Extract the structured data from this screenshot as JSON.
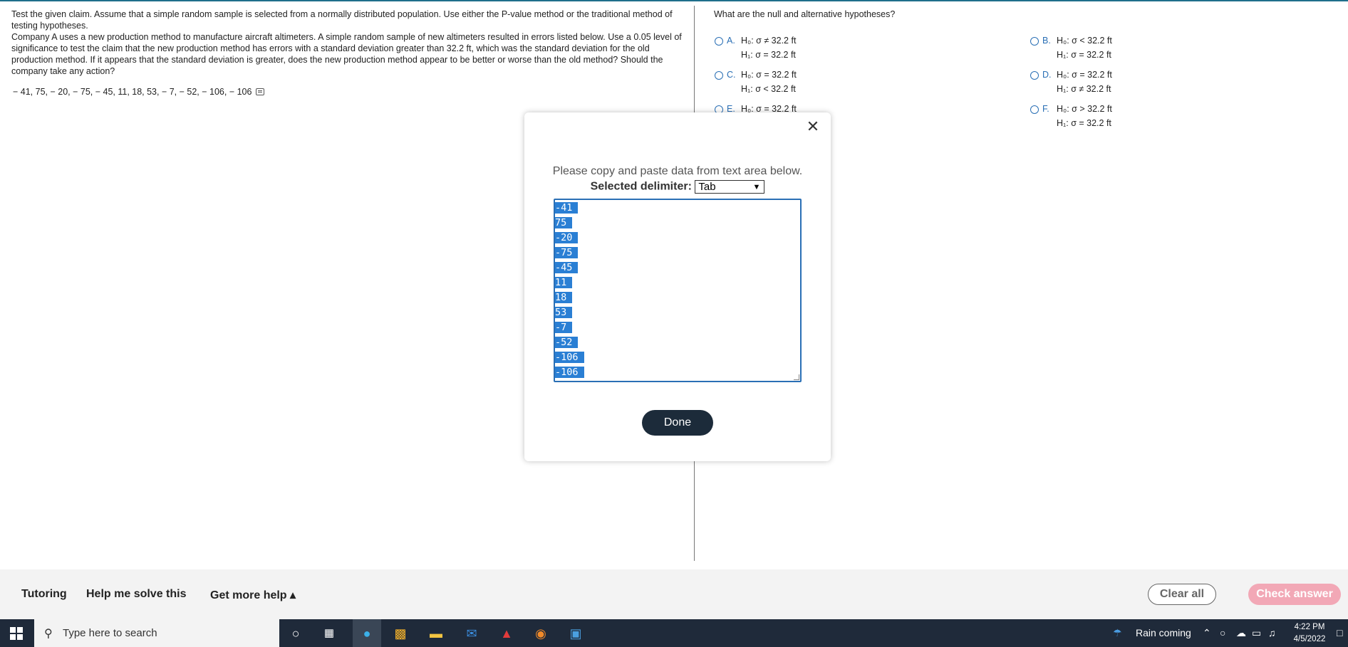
{
  "question": {
    "intro": "Test the given claim. Assume that a simple random sample is selected from a normally distributed population. Use either the P-value method or the traditional method of testing hypotheses.",
    "body": "Company A uses a new production method to manufacture aircraft altimeters. A simple random sample of new altimeters resulted in errors listed below. Use a 0.05 level of significance to test the claim that the new production method has errors with a standard deviation greater than 32.2 ft, which was the standard deviation for the old production method. If it appears that the standard deviation is greater, does the new production method appear to be better or worse than the old method? Should the company take any action?",
    "data_values": "− 41, 75, − 20, − 75, − 45, 11, 18, 53, − 7, − 52, − 106, − 106"
  },
  "answer": {
    "prompt": "What are the null and alternative hypotheses?",
    "options": [
      {
        "letter": "A.",
        "h0": "H₀: σ ≠ 32.2 ft",
        "h1": "H₁: σ = 32.2 ft"
      },
      {
        "letter": "B.",
        "h0": "H₀: σ < 32.2 ft",
        "h1": "H₁: σ = 32.2 ft"
      },
      {
        "letter": "C.",
        "h0": "H₀: σ = 32.2 ft",
        "h1": "H₁: σ < 32.2 ft"
      },
      {
        "letter": "D.",
        "h0": "H₀: σ = 32.2 ft",
        "h1": "H₁: σ ≠ 32.2 ft"
      },
      {
        "letter": "E.",
        "h0": "H₀: σ = 32.2 ft",
        "h1": ""
      },
      {
        "letter": "F.",
        "h0": "H₀: σ > 32.2 ft",
        "h1": "H₁: σ = 32.2 ft"
      }
    ]
  },
  "modal": {
    "close_icon": "✕",
    "instruction": "Please copy and paste data from text area below.",
    "delimiter_label": "Selected delimiter:",
    "delimiter_value": "Tab",
    "rows": [
      "-41",
      "75",
      "-20",
      "-75",
      "-45",
      "11",
      "18",
      "53",
      "-7",
      "-52",
      "-106",
      "-106"
    ],
    "done_label": "Done"
  },
  "help_bar": {
    "tutoring": "Tutoring",
    "help_solve": "Help me solve this",
    "more_help": "Get more help ▴",
    "clear_all": "Clear all",
    "check_answer": "Check answer"
  },
  "taskbar": {
    "search_placeholder": "Type here to search",
    "weather": "Rain coming",
    "time": "4:22 PM",
    "date": "4/5/2022"
  },
  "colors": {
    "accent_blue": "#2a6fb5",
    "done_button": "#1c2b3a",
    "check_answer": "#f2a8b6",
    "taskbar": "#1f2a3a"
  }
}
